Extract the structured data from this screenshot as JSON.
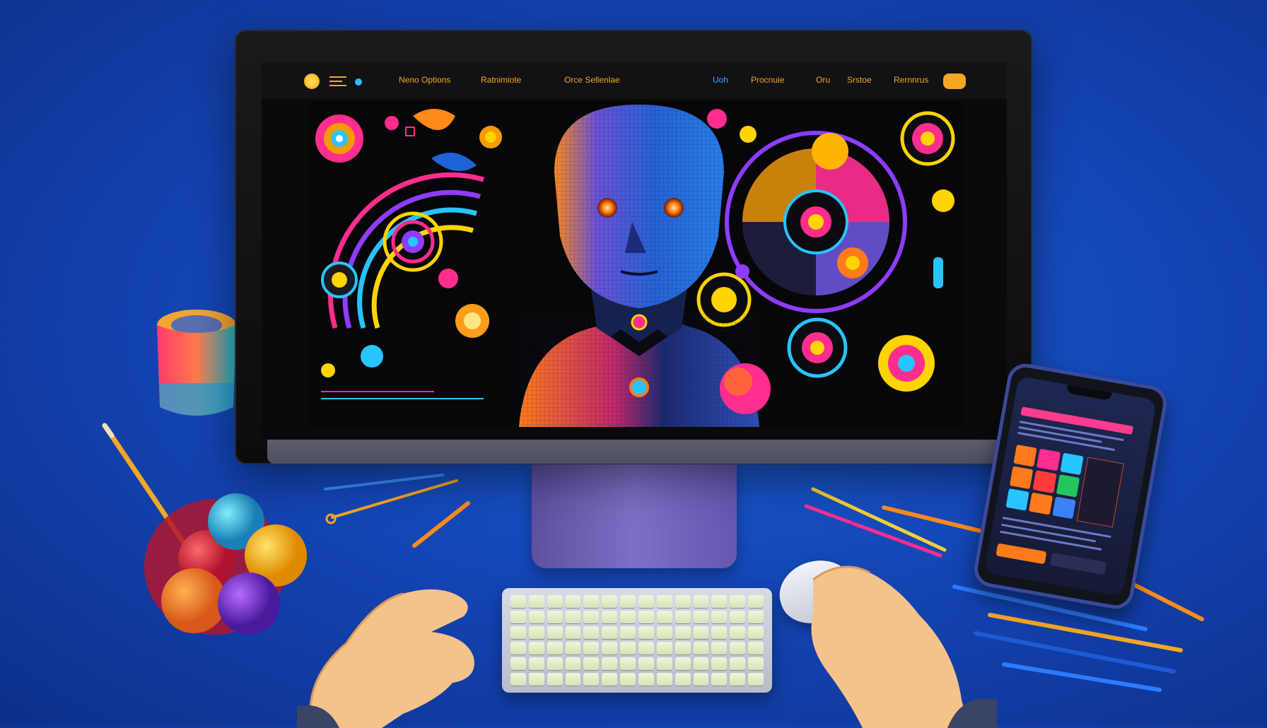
{
  "screen": {
    "nav": {
      "links": [
        "Nenо Options",
        "Ratnimiote",
        "Orce Sellenlae",
        "Uoh",
        "Procnuie",
        "Oru",
        "Srstoe",
        "Rernnrus"
      ]
    }
  },
  "colors": {
    "background": "#1447b8",
    "nav_text": "#f5a623",
    "nav_accent_blue": "#4aa3ff",
    "neon_pink": "#ff2d8d",
    "neon_yellow": "#ffd400",
    "neon_cyan": "#28c4ff",
    "neon_purple": "#8e3cff"
  },
  "icons": {
    "logo": "circle-logo-icon",
    "menu": "hamburger-menu-icon",
    "cta": "orange-pill-button"
  }
}
